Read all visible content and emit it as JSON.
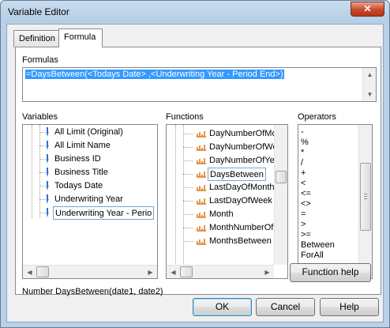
{
  "window": {
    "title": "Variable Editor",
    "close_glyph": "✕"
  },
  "tabs": [
    {
      "label": "Definition",
      "active": false
    },
    {
      "label": "Formula",
      "active": true
    }
  ],
  "formulas": {
    "label": "Formulas",
    "value": "=DaysBetween(<Todays Date> ,<Underwriting Year - Period End>)"
  },
  "variables": {
    "label": "Variables",
    "items": [
      "All Limit (Original)",
      "All Limit Name",
      "Business ID",
      "Business Title",
      "Todays Date",
      "Underwriting Year",
      "Underwriting Year - Perio"
    ],
    "selected": "Underwriting Year - Perio"
  },
  "functions": {
    "label": "Functions",
    "items": [
      "DayNumberOfMo",
      "DayNumberOfWe",
      "DayNumberOfYe",
      "DaysBetween",
      "LastDayOfMonth",
      "LastDayOfWeek",
      "Month",
      "MonthNumberOf",
      "MonthsBetween"
    ],
    "selected": "DaysBetween"
  },
  "operators": {
    "label": "Operators",
    "items": [
      "-",
      "%",
      "*",
      "/",
      "+",
      "<",
      "<=",
      "<>",
      "=",
      ">",
      ">=",
      "Between",
      "ForAll"
    ]
  },
  "signature": "Number DaysBetween(date1, date2)",
  "buttons": {
    "function_help": "Function help",
    "ok": "OK",
    "cancel": "Cancel",
    "help": "Help"
  },
  "colors": {
    "selection": "#3399ff",
    "icon_orange": "#e07b1a",
    "icon_blue": "#2f6fd6"
  },
  "icons": {
    "variable": "pin-icon",
    "function": "function-icon"
  }
}
